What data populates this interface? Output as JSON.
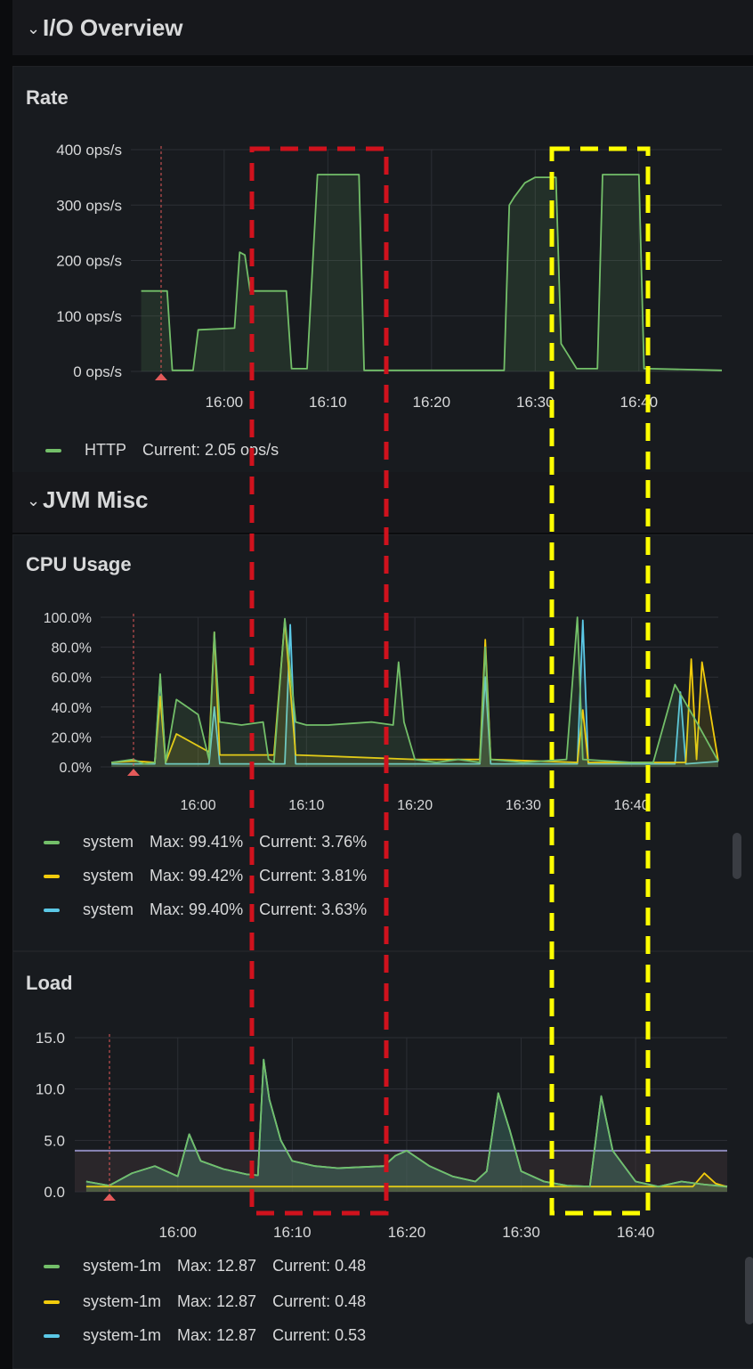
{
  "rows": [
    {
      "caret": "⌄",
      "title": "I/O Overview"
    },
    {
      "caret": "⌄",
      "title": "JVM Misc"
    }
  ],
  "panels": {
    "rate": {
      "title": "Rate",
      "legend": [
        {
          "name": "HTTP",
          "stats": "Current: 2.05 ops/s",
          "color": "#73bf69"
        }
      ]
    },
    "cpu": {
      "title": "CPU Usage",
      "legend": [
        {
          "name": "system",
          "max": "Max: 99.41%",
          "current": "Current: 3.76%",
          "color": "#73bf69"
        },
        {
          "name": "system",
          "max": "Max: 99.42%",
          "current": "Current: 3.81%",
          "color": "#f2cc0c"
        },
        {
          "name": "system",
          "max": "Max: 99.40%",
          "current": "Current: 3.63%",
          "color": "#5bc8e6"
        }
      ]
    },
    "load": {
      "title": "Load",
      "legend": [
        {
          "name": "system-1m",
          "max": "Max: 12.87",
          "current": "Current: 0.48",
          "color": "#73bf69"
        },
        {
          "name": "system-1m",
          "max": "Max: 12.87",
          "current": "Current: 0.48",
          "color": "#f2cc0c"
        },
        {
          "name": "system-1m",
          "max": "Max: 12.87",
          "current": "Current: 0.53",
          "color": "#5bc8e6"
        }
      ]
    }
  },
  "chart_data": [
    {
      "type": "area",
      "ytick_labels": [
        "400 ops/s",
        "300 ops/s",
        "200 ops/s",
        "100 ops/s",
        "0 ops/s"
      ],
      "xtick_labels": [
        "16:00",
        "16:10",
        "16:20",
        "16:30",
        "16:40"
      ],
      "ylim": [
        0,
        400
      ],
      "series": [
        {
          "color": "#73bf69",
          "x": [
            "15:52",
            "15:54.5",
            "15:55",
            "15:56",
            "15:57",
            "15:57.5",
            "16:01",
            "16:01.5",
            "16:02",
            "16:02.5",
            "16:06",
            "16:06.5",
            "16:07",
            "16:08",
            "16:09",
            "16:09.5",
            "16:13",
            "16:13.5",
            "16:14",
            "16:20",
            "16:27",
            "16:27.5",
            "16:28",
            "16:29",
            "16:30",
            "16:31",
            "16:32",
            "16:32.5",
            "16:33",
            "16:34",
            "16:35",
            "16:36",
            "16:36.5",
            "16:40",
            "16:40.5",
            "16:41",
            "16:48"
          ],
          "values": [
            145,
            145,
            2,
            2,
            2,
            75,
            78,
            215,
            210,
            145,
            145,
            5,
            5,
            5,
            355,
            355,
            355,
            2,
            2,
            2,
            2,
            300,
            315,
            340,
            350,
            350,
            350,
            50,
            35,
            5,
            5,
            5,
            355,
            355,
            5,
            5,
            2
          ]
        }
      ]
    },
    {
      "type": "area",
      "ytick_labels": [
        "100.0%",
        "80.0%",
        "60.0%",
        "40.0%",
        "20.0%",
        "0.0%"
      ],
      "xtick_labels": [
        "16:00",
        "16:10",
        "16:20",
        "16:30",
        "16:40"
      ],
      "ylim": [
        0,
        100
      ],
      "series": [
        {
          "color": "#73bf69",
          "x": [
            "15:52",
            "15:54",
            "15:55",
            "15:56",
            "15:56.5",
            "15:57",
            "15:58",
            "15:59",
            "16:00",
            "16:01",
            "16:01.5",
            "16:02",
            "16:04",
            "16:06",
            "16:06.5",
            "16:07",
            "16:08",
            "16:09",
            "16:10",
            "16:12",
            "16:14",
            "16:16",
            "16:18",
            "16:18.5",
            "16:19",
            "16:20",
            "16:22",
            "16:24",
            "16:26",
            "16:26.5",
            "16:27",
            "16:30",
            "16:34",
            "16:35",
            "16:35.5",
            "16:40",
            "16:42",
            "16:44",
            "16:46",
            "16:48"
          ],
          "values": [
            3,
            5,
            2,
            3,
            62,
            3,
            45,
            40,
            35,
            5,
            90,
            30,
            28,
            30,
            5,
            3,
            99,
            30,
            28,
            28,
            29,
            30,
            28,
            70,
            30,
            5,
            3,
            5,
            3,
            80,
            5,
            3,
            5,
            100,
            5,
            3,
            3,
            55,
            30,
            3.76
          ]
        },
        {
          "color": "#f2cc0c",
          "x": [
            "15:52",
            "15:54",
            "15:56",
            "15:56.5",
            "15:57",
            "15:58",
            "16:01",
            "16:01.5",
            "16:02",
            "16:07",
            "16:08",
            "16:09",
            "16:20",
            "16:26",
            "16:26.5",
            "16:27",
            "16:35",
            "16:35.5",
            "16:36",
            "16:45",
            "16:45.5",
            "16:46",
            "16:46.5",
            "16:48"
          ],
          "values": [
            3,
            4,
            3,
            47,
            3,
            22,
            10,
            90,
            8,
            8,
            98,
            8,
            5,
            5,
            85,
            5,
            3,
            38,
            3,
            3,
            72,
            5,
            70,
            3.81
          ]
        },
        {
          "color": "#5bc8e6",
          "x": [
            "15:52",
            "15:56",
            "15:56.5",
            "15:57",
            "16:01",
            "16:01.5",
            "16:02",
            "16:08",
            "16:08.5",
            "16:09",
            "16:26",
            "16:26.5",
            "16:27",
            "16:35",
            "16:35.5",
            "16:36",
            "16:44",
            "16:44.5",
            "16:45",
            "16:48"
          ],
          "values": [
            2,
            2,
            60,
            2,
            2,
            40,
            2,
            2,
            95,
            2,
            2,
            60,
            2,
            2,
            98,
            2,
            2,
            50,
            2,
            3.63
          ]
        }
      ]
    },
    {
      "type": "area",
      "ytick_labels": [
        "15.0",
        "10.0",
        "5.0",
        "0.0"
      ],
      "xtick_labels": [
        "16:00",
        "16:10",
        "16:20",
        "16:30",
        "16:40"
      ],
      "ylim": [
        0,
        15
      ],
      "series": [
        {
          "color": "#73bf69",
          "x": [
            "15:52",
            "15:54",
            "15:56",
            "15:58",
            "16:00",
            "16:01",
            "16:02",
            "16:04",
            "16:06",
            "16:07",
            "16:07.5",
            "16:08",
            "16:09",
            "16:10",
            "16:12",
            "16:14",
            "16:16",
            "16:18",
            "16:19",
            "16:20",
            "16:22",
            "16:24",
            "16:26",
            "16:27",
            "16:28",
            "16:29",
            "16:30",
            "16:32",
            "16:34",
            "16:36",
            "16:37",
            "16:38",
            "16:40",
            "16:42",
            "16:44",
            "16:46",
            "16:48"
          ],
          "values": [
            1,
            0.6,
            1.8,
            2.5,
            1.5,
            5.6,
            3,
            2.2,
            1.7,
            1.6,
            12.87,
            9,
            5,
            3,
            2.5,
            2.3,
            2.4,
            2.5,
            3.5,
            4,
            2.5,
            1.5,
            1,
            2,
            9.6,
            6,
            2,
            1,
            0.6,
            0.5,
            9.3,
            4,
            1,
            0.5,
            1,
            0.7,
            0.48
          ]
        },
        {
          "color": "#f2cc0c",
          "x": [
            "15:52",
            "16:45",
            "16:46",
            "16:47",
            "16:48"
          ],
          "values": [
            0.5,
            0.5,
            1.8,
            0.8,
            0.48
          ]
        },
        {
          "color": "#5bc8e6",
          "x": [
            "15:52",
            "15:54",
            "15:56",
            "15:58",
            "16:00",
            "16:01",
            "16:02",
            "16:04",
            "16:06",
            "16:07",
            "16:07.5",
            "16:08",
            "16:09",
            "16:10",
            "16:12",
            "16:14",
            "16:16",
            "16:18",
            "16:19",
            "16:20",
            "16:22",
            "16:24",
            "16:26",
            "16:27",
            "16:28",
            "16:29",
            "16:30",
            "16:32",
            "16:34",
            "16:36",
            "16:37",
            "16:38",
            "16:40",
            "16:42",
            "16:44",
            "16:46",
            "16:48"
          ],
          "values": [
            1,
            0.6,
            1.8,
            2.5,
            1.5,
            5.6,
            3,
            2.2,
            1.7,
            1.6,
            12.87,
            9,
            5,
            3,
            2.5,
            2.3,
            2.4,
            2.5,
            3.5,
            4,
            2.5,
            1.5,
            1,
            2,
            9.6,
            6,
            2,
            1,
            0.6,
            0.5,
            9.3,
            4,
            1,
            0.5,
            1,
            0.7,
            0.53
          ]
        }
      ]
    }
  ],
  "annotations": {
    "red_box_color": "#d0121d",
    "yellow_box_color": "#ffff00"
  }
}
